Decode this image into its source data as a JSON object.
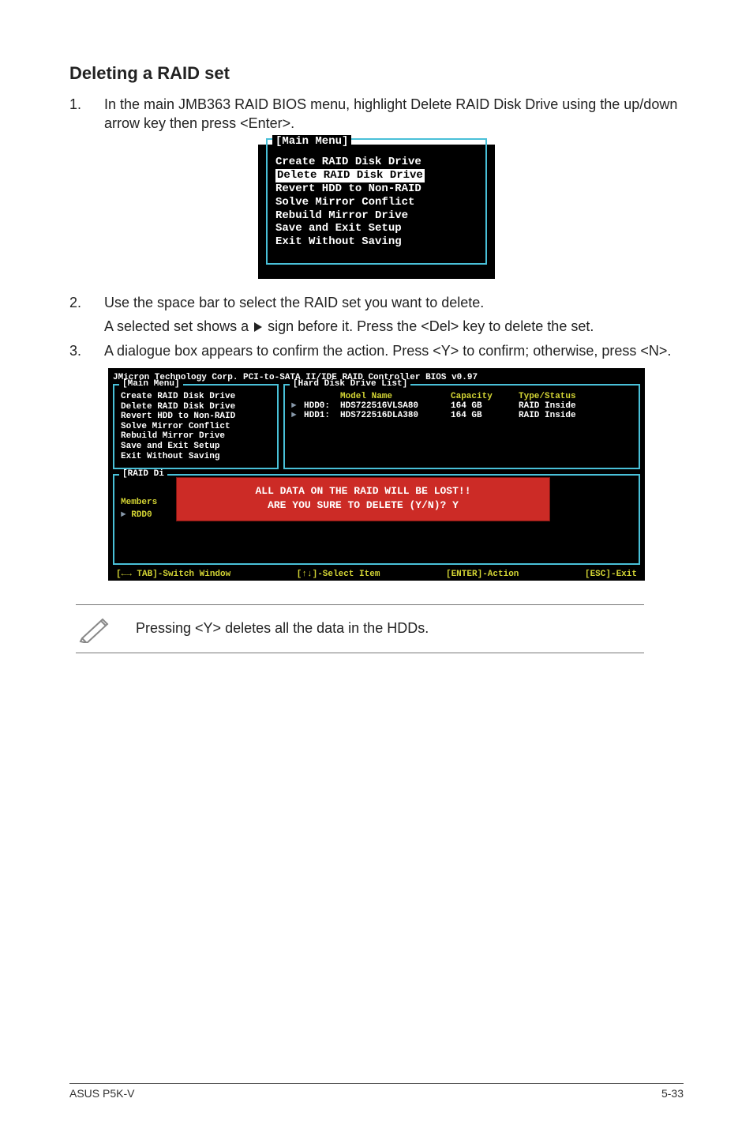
{
  "section_title": "Deleting a RAID set",
  "steps": [
    {
      "n": "1.",
      "text": "In the main JMB363 RAID BIOS menu, highlight Delete RAID Disk Drive using the up/down arrow key then press <Enter>."
    },
    {
      "n": "2.",
      "text": "Use the space bar to select the RAID set you want to delete.",
      "sub": "A selected set shows a    sign before it. Press the <Del> key to delete the set."
    },
    {
      "n": "3.",
      "text": "A dialogue box appears to confirm the action. Press <Y> to confirm; otherwise, press <N>."
    }
  ],
  "bios_small": {
    "frame_title": "[Main Menu]",
    "items": [
      "Create RAID Disk Drive",
      "Delete RAID Disk Drive",
      "Revert HDD to Non-RAID",
      "Solve Mirror Conflict",
      "Rebuild Mirror Drive",
      "Save and Exit Setup",
      "Exit Without Saving"
    ],
    "selected_index": 1
  },
  "bios_large": {
    "top": "JMicron Technology Corp. PCI-to-SATA II/IDE RAID Controller BIOS v0.97",
    "main_label": "[Main Menu]",
    "main_items": [
      "Create RAID Disk Drive",
      "Delete RAID Disk Drive",
      "Revert HDD to Non-RAID",
      "Solve Mirror Conflict",
      "Rebuild Mirror Drive",
      "Save and Exit Setup",
      "Exit Without Saving"
    ],
    "hdd_label": "[Hard Disk Drive List]",
    "hdd_headers": {
      "model": "Model Name",
      "cap": "Capacity",
      "type": "Type/Status"
    },
    "hdd_rows": [
      {
        "id": "HDD0:",
        "model": "HDS722516VLSA80",
        "cap": "164 GB",
        "type": "RAID Inside"
      },
      {
        "id": "HDD1:",
        "model": "HDS722516DLA380",
        "cap": "164 GB",
        "type": "RAID Inside"
      }
    ],
    "raid_label": "[RAID Di",
    "raid_members": "Members",
    "raid_rdd": "RDD0",
    "popup_line1": "ALL DATA ON THE RAID WILL BE LOST!!",
    "popup_line2": "ARE YOU SURE TO DELETE (Y/N)? Y",
    "keybar": {
      "k1": "[←→ TAB]-Switch Window",
      "k2": "[↑↓]-Select Item",
      "k3": "[ENTER]-Action",
      "k4": "[ESC]-Exit"
    }
  },
  "note_text": "Pressing <Y> deletes all the data in the HDDs.",
  "footer_left": "ASUS P5K-V",
  "footer_right": "5-33"
}
